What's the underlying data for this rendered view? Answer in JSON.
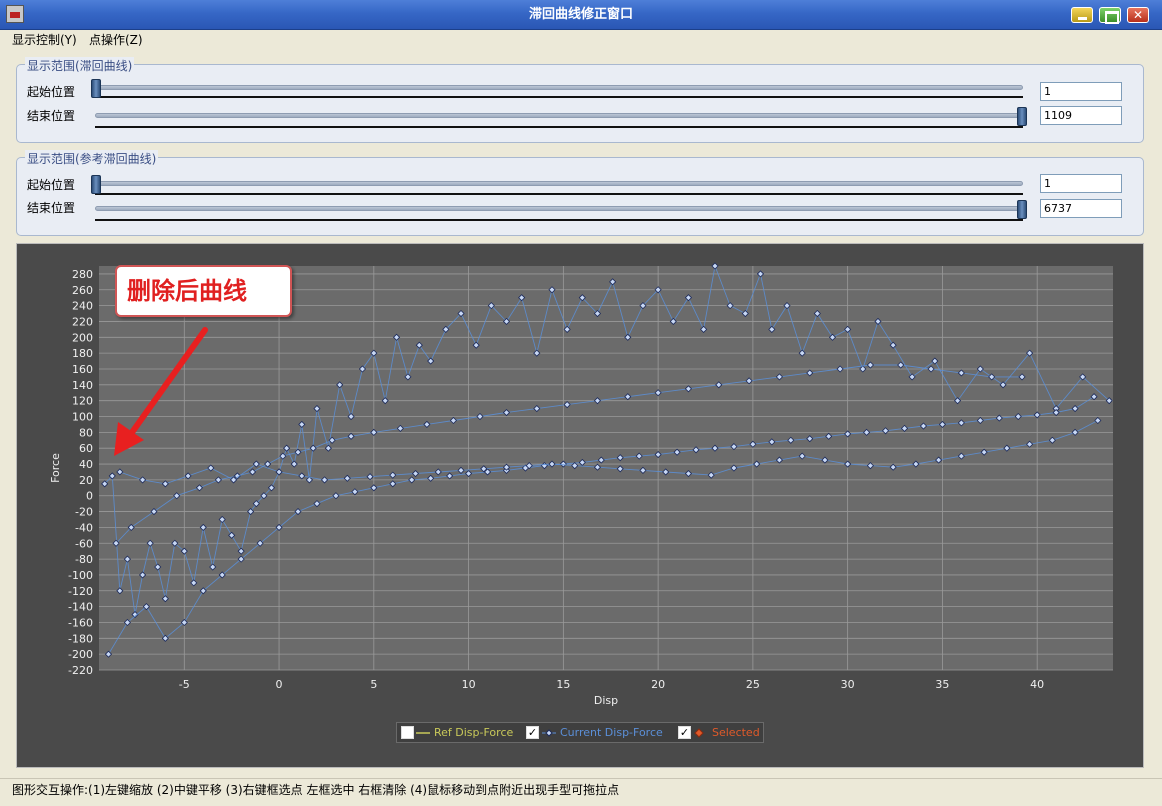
{
  "window": {
    "title": "滞回曲线修正窗口"
  },
  "menu": {
    "items": [
      "显示控制(Y)",
      "点操作(Z)"
    ]
  },
  "range_main": {
    "title": "显示范围(滞回曲线)",
    "start_label": "起始位置",
    "end_label": "结束位置",
    "start_value": "1",
    "end_value": "1109",
    "min": 1,
    "max": 1109
  },
  "range_ref": {
    "title": "显示范围(参考滞回曲线)",
    "start_label": "起始位置",
    "end_label": "结束位置",
    "start_value": "1",
    "end_value": "6737",
    "min": 1,
    "max": 6737
  },
  "annotation": {
    "text": "删除后曲线",
    "color": "#e02020"
  },
  "legend": {
    "items": [
      {
        "label": "Ref Disp-Force",
        "checked": false,
        "color": "#c9c95a"
      },
      {
        "label": "Current Disp-Force",
        "checked": true,
        "color": "#5b8fd8"
      },
      {
        "label": "Selected",
        "checked": true,
        "color": "#e05a2a"
      }
    ]
  },
  "status": {
    "text": "图形交互操作:(1)左键缩放 (2)中键平移 (3)右键框选点 左框选中 右框清除 (4)鼠标移动到点附近出现手型可拖拉点"
  },
  "colors": {
    "plot_bg": "#6b6b6b",
    "frame_bg": "#4a4a4a",
    "series": "#5b8fd8",
    "marker_stroke": "#1c2a5a",
    "marker_fill": "#c8d8f4"
  },
  "chart_data": {
    "type": "line",
    "xlabel": "Disp",
    "ylabel": "Force",
    "xlim": [
      -9.5,
      44
    ],
    "ylim": [
      -220,
      290
    ],
    "xticks": [
      -5,
      0,
      5,
      10,
      15,
      20,
      25,
      30,
      35,
      40
    ],
    "yticks": [
      -220,
      -200,
      -180,
      -160,
      -140,
      -120,
      -100,
      -80,
      -60,
      -40,
      -20,
      0,
      20,
      40,
      60,
      80,
      100,
      120,
      140,
      160,
      180,
      200,
      220,
      240,
      260,
      280
    ],
    "grid": true,
    "series": [
      {
        "name": "Current Disp-Force",
        "x": [
          -9.2,
          -8.8,
          -8.4,
          -8.0,
          -7.6,
          -7.2,
          -6.8,
          -6.4,
          -6.0,
          -5.5,
          -5.0,
          -4.5,
          -4.0,
          -3.5,
          -3.0,
          -2.5,
          -2.0,
          -1.5,
          -1.2,
          -0.8,
          -0.4,
          0.0,
          0.4,
          0.8,
          1.2,
          1.6,
          2.0,
          2.6,
          3.2,
          3.8,
          4.4,
          5.0,
          5.6,
          6.2,
          6.8,
          7.4,
          8.0,
          8.8,
          9.6,
          10.4,
          11.2,
          12.0,
          12.8,
          13.6,
          14.4,
          15.2,
          16.0,
          16.8,
          17.6,
          18.4,
          19.2,
          20.0,
          20.8,
          21.6,
          22.4,
          23.0,
          23.8,
          24.6,
          25.4,
          26.0,
          26.8,
          27.6,
          28.4,
          29.2,
          30.0,
          30.8,
          31.6,
          32.4,
          33.4,
          34.6,
          35.8,
          37.0,
          38.2,
          39.6,
          41.0,
          42.4,
          43.8
        ],
        "y": [
          15,
          25,
          -120,
          -80,
          -150,
          -100,
          -60,
          -90,
          -130,
          -60,
          -70,
          -110,
          -40,
          -90,
          -30,
          -50,
          -70,
          -20,
          -10,
          0,
          10,
          30,
          60,
          40,
          90,
          20,
          110,
          60,
          140,
          100,
          160,
          180,
          120,
          200,
          150,
          190,
          170,
          210,
          230,
          190,
          240,
          220,
          250,
          180,
          260,
          210,
          250,
          230,
          270,
          200,
          240,
          260,
          220,
          250,
          210,
          290,
          240,
          230,
          280,
          210,
          240,
          180,
          230,
          200,
          210,
          160,
          220,
          190,
          150,
          170,
          120,
          160,
          140,
          180,
          110,
          150,
          120
        ]
      },
      {
        "name": "Current Disp-Force",
        "x": [
          -9.0,
          -8.0,
          -7.0,
          -6.0,
          -5.0,
          -4.0,
          -3.0,
          -2.0,
          -1.0,
          0.0,
          1.0,
          2.0,
          3.0,
          4.0,
          5.0,
          6.0,
          7.0,
          8.0,
          9.0,
          10.0,
          11.0,
          12.0,
          13.0,
          14.0,
          15.0,
          16.0,
          17.0,
          18.0,
          19.0,
          20.0,
          21.0,
          22.0,
          23.0,
          24.0,
          25.0,
          26.0,
          27.0,
          28.0,
          29.0,
          30.0,
          31.0,
          32.0,
          33.0,
          34.0,
          35.0,
          36.0,
          37.0,
          38.0,
          39.0,
          40.0,
          41.0,
          42.0,
          43.0
        ],
        "y": [
          -200,
          -160,
          -140,
          -180,
          -160,
          -120,
          -100,
          -80,
          -60,
          -40,
          -20,
          -10,
          0,
          5,
          10,
          15,
          20,
          22,
          25,
          28,
          30,
          32,
          35,
          38,
          40,
          42,
          45,
          48,
          50,
          52,
          55,
          58,
          60,
          62,
          65,
          68,
          70,
          72,
          75,
          78,
          80,
          82,
          85,
          88,
          90,
          92,
          95,
          98,
          100,
          102,
          105,
          110,
          125
        ]
      },
      {
        "name": "Current Disp-Force",
        "x": [
          -8.6,
          -7.8,
          -6.6,
          -5.4,
          -4.2,
          -3.2,
          -2.2,
          -1.4,
          -0.6,
          0.2,
          1.0,
          1.8,
          2.8,
          3.8,
          5.0,
          6.4,
          7.8,
          9.2,
          10.6,
          12.0,
          13.6,
          15.2,
          16.8,
          18.4,
          20.0,
          21.6,
          23.2,
          24.8,
          26.4,
          28.0,
          29.6,
          31.2,
          32.8,
          34.4,
          36.0,
          37.6,
          39.2
        ],
        "y": [
          -60,
          -40,
          -20,
          0,
          10,
          20,
          25,
          30,
          40,
          50,
          55,
          60,
          70,
          75,
          80,
          85,
          90,
          95,
          100,
          105,
          110,
          115,
          120,
          125,
          130,
          135,
          140,
          145,
          150,
          155,
          160,
          165,
          165,
          160,
          155,
          150,
          150
        ]
      },
      {
        "name": "Current Disp-Force",
        "x": [
          -8.4,
          -7.2,
          -6.0,
          -4.8,
          -3.6,
          -2.4,
          -1.2,
          0.0,
          1.2,
          2.4,
          3.6,
          4.8,
          6.0,
          7.2,
          8.4,
          9.6,
          10.8,
          12.0,
          13.2,
          14.4,
          15.6,
          16.8,
          18.0,
          19.2,
          20.4,
          21.6,
          22.8,
          24.0,
          25.2,
          26.4,
          27.6,
          28.8,
          30.0,
          31.2,
          32.4,
          33.6,
          34.8,
          36.0,
          37.2,
          38.4,
          39.6,
          40.8,
          42.0,
          43.2
        ],
        "y": [
          30,
          20,
          15,
          25,
          35,
          20,
          40,
          30,
          25,
          20,
          22,
          24,
          26,
          28,
          30,
          32,
          34,
          36,
          38,
          40,
          38,
          36,
          34,
          32,
          30,
          28,
          26,
          35,
          40,
          45,
          50,
          45,
          40,
          38,
          36,
          40,
          45,
          50,
          55,
          60,
          65,
          70,
          80,
          95
        ]
      }
    ]
  }
}
